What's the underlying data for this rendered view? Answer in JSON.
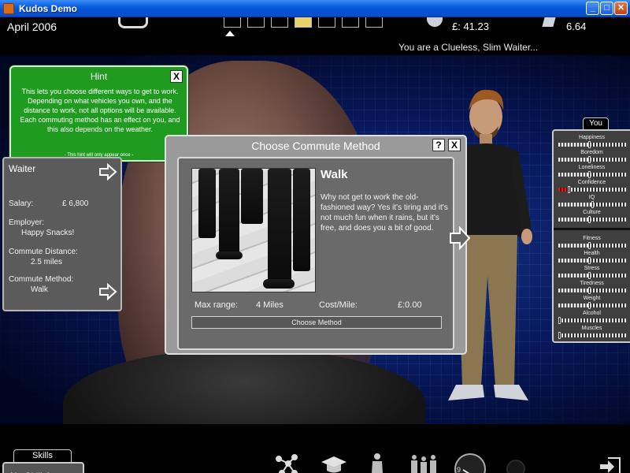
{
  "window": {
    "title": "Kudos Demo",
    "minimize": "_",
    "maximize": "□",
    "close": "✕"
  },
  "topbar": {
    "date": "April 2006",
    "money": "£: 41.23",
    "other_stat": "6.64",
    "status": "You are a Clueless, Slim Waiter...",
    "icons": [
      "cycle-icon",
      "money-icon",
      "stat-icon"
    ]
  },
  "hint": {
    "title": "Hint",
    "close": "X",
    "body": "This lets you choose different ways to get to work. Depending on what vehicles you own, and the distance to work, not all options will be available. Each commuting method has an effect on you, and this also depends on the weather.",
    "footer": "- This hint will only appear once -"
  },
  "job": {
    "title": "Waiter",
    "salary_label": "Salary:",
    "salary_value": "£ 6,800",
    "employer_label": "Employer:",
    "employer_value": "Happy Snacks!",
    "distance_label": "Commute Distance:",
    "distance_value": "2.5 miles",
    "method_label": "Commute Method:",
    "method_value": "Walk"
  },
  "dialog": {
    "title": "Choose Commute Method",
    "help": "?",
    "close": "X",
    "method_name": "Walk",
    "description": "Why not get to work the old-fashioned way? Yes it's tiring and it's not much fun when it rains, but it's free, and does you a bit of good.",
    "max_range_label": "Max range:",
    "max_range_value": "4 Miles",
    "cost_label": "Cost/Mile:",
    "cost_value": "£:0.00",
    "choose_button": "Choose Method"
  },
  "stats": {
    "tab": "You",
    "mood": [
      {
        "label": "Happiness",
        "value": 0.45
      },
      {
        "label": "Boredom",
        "value": 0.45
      },
      {
        "label": "Loneliness",
        "value": 0.45
      },
      {
        "label": "Confidence",
        "value": 0.15,
        "alert": true
      },
      {
        "label": "IQ",
        "value": 0.5
      },
      {
        "label": "Culture",
        "value": 0.45
      }
    ],
    "body": [
      {
        "label": "Fitness",
        "value": 0.45
      },
      {
        "label": "Health",
        "value": 0.45
      },
      {
        "label": "Stress",
        "value": 0.45
      },
      {
        "label": "Tiredness",
        "value": 0.45
      },
      {
        "label": "Weight",
        "value": 0.45
      },
      {
        "label": "Alcohol",
        "value": 0
      },
      {
        "label": "Muscles",
        "value": 0
      }
    ]
  },
  "bottombar": {
    "skills_tab": "Skills",
    "skills_value": "No Skills!",
    "clock_top": "9",
    "clock_bottom": "5",
    "tools": [
      "network-icon",
      "graduation-cap-icon",
      "person-icon",
      "group-icon",
      "clock-icon",
      "exit-icon"
    ]
  }
}
